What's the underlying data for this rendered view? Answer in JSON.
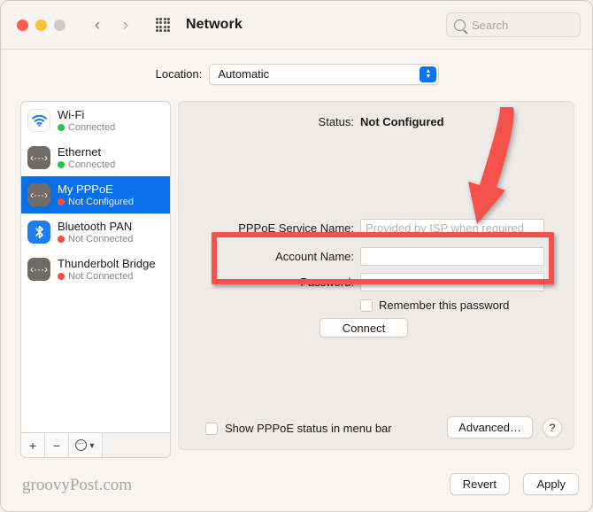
{
  "window": {
    "title": "Network",
    "traffic_lights": [
      "close",
      "minimize",
      "zoom"
    ],
    "back_icon": "chevron-left-icon",
    "forward_icon": "chevron-right-icon",
    "grid_icon": "show-all-grid-icon"
  },
  "search": {
    "placeholder": "Search",
    "icon": "search-icon",
    "value": ""
  },
  "location": {
    "label": "Location:",
    "value": "Automatic",
    "stepper_icon": "chevron-up-down-icon",
    "accent": "#0a74ec"
  },
  "sidebar": {
    "items": [
      {
        "name": "Wi-Fi",
        "status": "Connected",
        "status_color": "#2fc24a",
        "icon": "wifi-icon",
        "selected": false
      },
      {
        "name": "Ethernet",
        "status": "Connected",
        "status_color": "#2fc24a",
        "icon": "ethernet-icon",
        "selected": false
      },
      {
        "name": "My PPPoE",
        "status": "Not Configured",
        "status_color": "#fa4b3c",
        "icon": "ethernet-icon",
        "selected": true
      },
      {
        "name": "Bluetooth PAN",
        "status": "Not Connected",
        "status_color": "#fa4b3c",
        "icon": "bluetooth-icon",
        "selected": false
      },
      {
        "name": "Thunderbolt Bridge",
        "status": "Not Connected",
        "status_color": "#fa4b3c",
        "icon": "ethernet-icon",
        "selected": false
      }
    ],
    "toolbar": {
      "add_label": "+",
      "remove_label": "−",
      "action_icon": "action-menu-icon",
      "action_chevron": "chevron-down-icon"
    },
    "selection_color": "#0a6fe8"
  },
  "main": {
    "status_label": "Status:",
    "status_value": "Not Configured",
    "fields": [
      {
        "label": "PPPoE Service Name:",
        "value": "",
        "placeholder": "Provided by ISP when required",
        "type": "text"
      },
      {
        "label": "Account Name:",
        "value": "",
        "placeholder": "",
        "type": "text"
      },
      {
        "label": "Password:",
        "value": "",
        "placeholder": "",
        "type": "password"
      }
    ],
    "remember_checkbox": {
      "label": "Remember this password",
      "checked": false
    },
    "connect_button": "Connect",
    "show_status_checkbox": {
      "label": "Show PPPoE status in menu bar",
      "checked": false
    },
    "advanced_button": "Advanced…",
    "help_button": "?"
  },
  "footer": {
    "revert_button": "Revert",
    "apply_button": "Apply",
    "watermark": "groovyPost.com"
  },
  "annotations": {
    "highlight_color": "#f4514a",
    "box_target": "account-name-and-password-fields",
    "arrow_target": "pppoe-service-name-field"
  }
}
